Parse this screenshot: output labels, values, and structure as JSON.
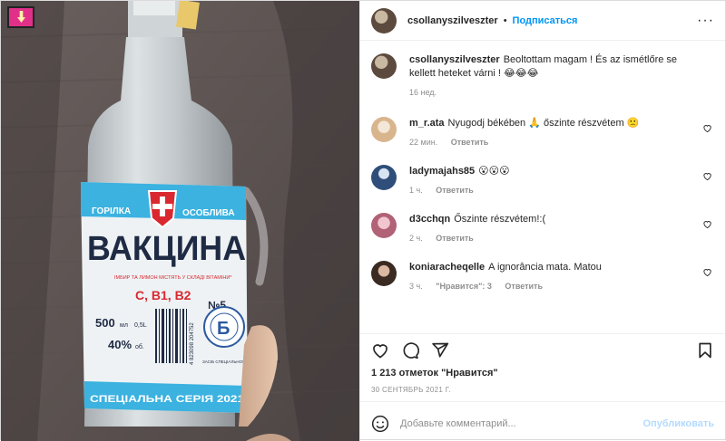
{
  "header": {
    "username": "csollanyszilveszter",
    "separator": "•",
    "follow_label": "Подписаться",
    "more_label": "···"
  },
  "photo": {
    "bottle": {
      "brand_left": "ГОРІЛКА",
      "brand_right": "ОСОБЛИВА",
      "title": "ВАКЦИНА",
      "subtitle": "ІМБИР ТА ЛИМОН МІСТЯТЬ У СКЛАДІ ВІТАМІНИ*",
      "vitamins": "C, B1, B2",
      "volume": "500",
      "volume_unit": "мл",
      "volume_alt": "0,5L",
      "strength": "40%",
      "strength_unit": "об.",
      "barcode": "4 823098 204752",
      "number": "№5",
      "badge_letter": "Б",
      "series": "СПЕЦІАЛЬНА СЕРІЯ 2021",
      "small_text": "ЗАСІБ СПЕЦІАЛЬНОГО ПРИЗНАЧЕННЯ"
    },
    "colors": {
      "label_blue": "#3bb2e0",
      "cross_red": "#d9282f",
      "title_dark": "#1f2b44"
    }
  },
  "caption": {
    "username": "csollanyszilveszter",
    "text": "Beoltottam magam ! És az ismétlőre se kellett heteket várni ! 😂😂😂",
    "time": "16 нед."
  },
  "comments": [
    {
      "username": "m_r.ata",
      "text": "Nyugodj békében 🙏 őszinte részvétem 🙁",
      "time": "22 мин.",
      "likes": "",
      "reply": "Ответить"
    },
    {
      "username": "ladymajahs85",
      "text": "😮😮😮",
      "time": "1 ч.",
      "likes": "",
      "reply": "Ответить"
    },
    {
      "username": "d3cchqn",
      "text": "Őszinte részvétem!:(",
      "time": "2 ч.",
      "likes": "",
      "reply": "Ответить"
    },
    {
      "username": "koniaracheqelle",
      "text": "A ignorância mata. Matou",
      "time": "3 ч.",
      "likes": "\"Нравится\": 3",
      "reply": "Ответить"
    }
  ],
  "likes": "1 213 отметок \"Нравится\"",
  "date": "30 СЕНТЯБРЬ 2021 Г.",
  "add_comment": {
    "placeholder": "Добавьте комментарий...",
    "post_label": "Опубликовать"
  },
  "icons": {
    "like": "heart-outline-icon",
    "comment": "comment-bubble-icon",
    "share": "paper-plane-icon",
    "save": "bookmark-icon",
    "emoji": "smiley-icon",
    "more": "ellipsis-icon"
  }
}
